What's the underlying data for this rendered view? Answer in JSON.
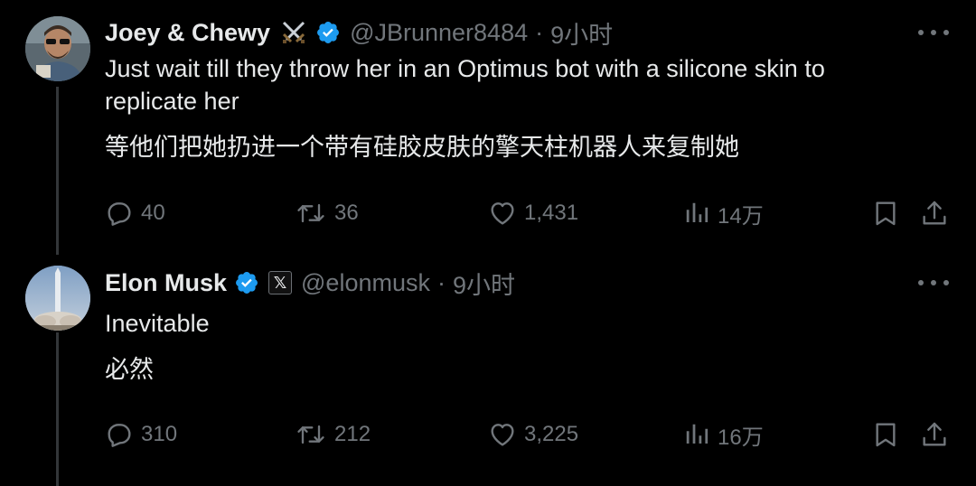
{
  "tweets": [
    {
      "display_name": "Joey & Chewy",
      "handle": "@JBrunner8484",
      "separator": "·",
      "time": "9小时",
      "text": "Just wait till they throw her in an Optimus bot with a silicone skin to replicate her",
      "translation": "等他们把她扔进一个带有硅胶皮肤的擎天柱机器人来复制她",
      "replies": "40",
      "reposts": "36",
      "likes": "1,431",
      "views": "14万",
      "icons": [
        "crossed-swords-icon",
        "verified-badge-icon",
        "more-icon",
        "reply-icon",
        "repost-icon",
        "like-icon",
        "views-icon",
        "bookmark-icon",
        "share-icon"
      ]
    },
    {
      "display_name": "Elon Musk",
      "affiliate_badge": "𝕏",
      "handle": "@elonmusk",
      "separator": "·",
      "time": "9小时",
      "text": "Inevitable",
      "translation": "必然",
      "replies": "310",
      "reposts": "212",
      "likes": "3,225",
      "views": "16万",
      "icons": [
        "verified-badge-icon",
        "x-affiliate-icon",
        "more-icon",
        "reply-icon",
        "repost-icon",
        "like-icon",
        "views-icon",
        "bookmark-icon",
        "share-icon"
      ]
    }
  ],
  "colors": {
    "background": "#000000",
    "text_primary": "#e7e9ea",
    "text_secondary": "#71767b",
    "verified_blue": "#1d9bf0",
    "thread_line": "#333639"
  }
}
